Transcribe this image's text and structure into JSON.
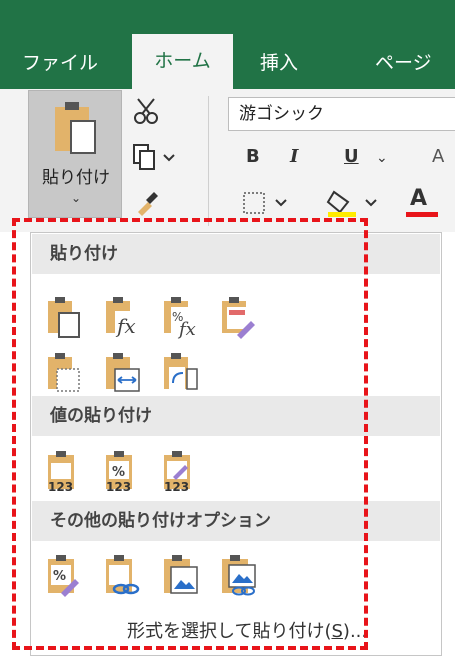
{
  "tabs": [
    {
      "label": "ファイル"
    },
    {
      "label": "ホーム"
    },
    {
      "label": "挿入"
    },
    {
      "label": "ページ"
    }
  ],
  "clipboard": {
    "paste_label": "貼り付け",
    "chevron": "⌄"
  },
  "font": {
    "name": "游ゴシック",
    "bold": "B",
    "italic": "I",
    "underline": "U",
    "font_color": "A"
  },
  "paste_menu": {
    "section_paste": "貼り付け",
    "section_values": "値の貼り付け",
    "section_other": "その他の貼り付けオプション",
    "footer_prefix": "形式を選択して貼り付け(",
    "footer_key": "S",
    "footer_suffix": ")..."
  },
  "colors": {
    "ribbon_green": "#217346",
    "highlight_red": "#e8141a",
    "clipboard_tan": "#e2b36a"
  }
}
